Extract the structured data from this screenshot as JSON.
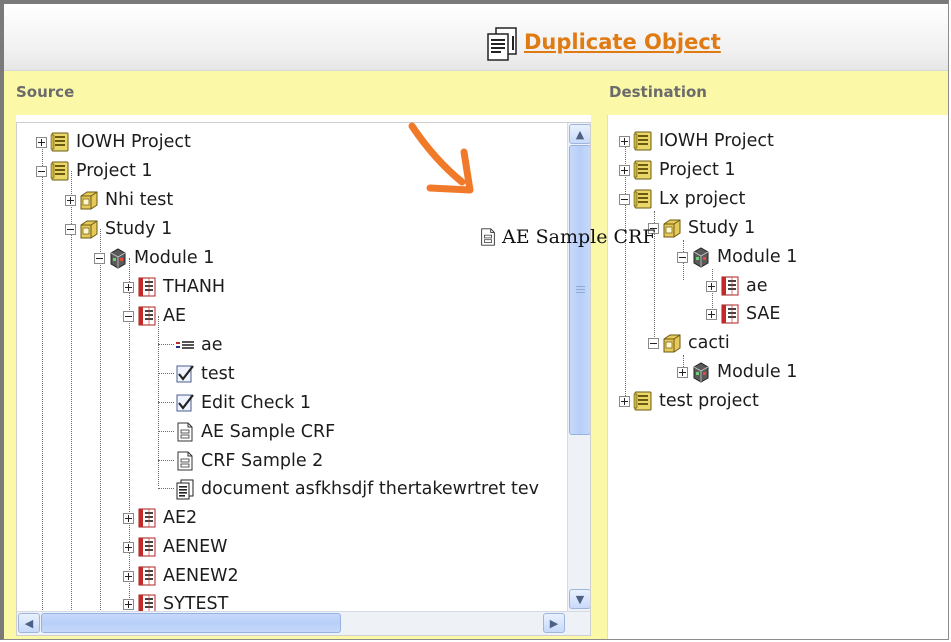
{
  "window": {
    "title": "Duplicate Object",
    "title_icon": "duplicate-document-icon"
  },
  "panes": {
    "source_label": "Source",
    "destination_label": "Destination"
  },
  "drag_ghost": {
    "label": "AE Sample CRF",
    "icon": "crf-form-icon"
  },
  "source_tree": [
    {
      "label": "IOWH Project",
      "icon": "project-icon",
      "state": "collapsed"
    },
    {
      "label": "Project 1",
      "icon": "project-icon",
      "state": "expanded"
    },
    {
      "label": "Nhi test",
      "icon": "study-icon",
      "state": "collapsed"
    },
    {
      "label": "Study 1",
      "icon": "study-icon",
      "state": "expanded"
    },
    {
      "label": "Module 1",
      "icon": "module-icon",
      "state": "expanded"
    },
    {
      "label": "THANH",
      "icon": "form-folder-icon",
      "state": "collapsed"
    },
    {
      "label": "AE",
      "icon": "form-folder-icon",
      "state": "expanded"
    },
    {
      "label": "ae",
      "icon": "list-icon",
      "state": "leaf"
    },
    {
      "label": "test",
      "icon": "edit-check-icon",
      "state": "leaf"
    },
    {
      "label": "Edit Check 1",
      "icon": "edit-check-icon",
      "state": "leaf"
    },
    {
      "label": "AE Sample CRF",
      "icon": "crf-form-icon",
      "state": "leaf"
    },
    {
      "label": "CRF Sample 2",
      "icon": "crf-form-icon",
      "state": "leaf"
    },
    {
      "label": "document asfkhsdjf thertakewrtret tev",
      "icon": "document-icon",
      "state": "leaf"
    },
    {
      "label": "AE2",
      "icon": "form-folder-icon",
      "state": "collapsed"
    },
    {
      "label": "AENEW",
      "icon": "form-folder-icon",
      "state": "collapsed"
    },
    {
      "label": "AENEW2",
      "icon": "form-folder-icon",
      "state": "collapsed"
    },
    {
      "label": "SYTEST",
      "icon": "form-folder-icon",
      "state": "collapsed"
    }
  ],
  "destination_tree": [
    {
      "label": "IOWH Project",
      "icon": "project-icon",
      "state": "collapsed"
    },
    {
      "label": "Project 1",
      "icon": "project-icon",
      "state": "collapsed"
    },
    {
      "label": "Lx project",
      "icon": "project-icon",
      "state": "expanded"
    },
    {
      "label": "Study 1",
      "icon": "study-icon",
      "state": "expanded"
    },
    {
      "label": "Module 1",
      "icon": "module-icon",
      "state": "expanded"
    },
    {
      "label": "ae",
      "icon": "form-folder-icon",
      "state": "collapsed"
    },
    {
      "label": "SAE",
      "icon": "form-folder-icon",
      "state": "collapsed"
    },
    {
      "label": "cacti",
      "icon": "study-icon",
      "state": "expanded"
    },
    {
      "label": "Module 1",
      "icon": "module-icon",
      "state": "collapsed"
    },
    {
      "label": "test project",
      "icon": "project-icon",
      "state": "collapsed"
    }
  ],
  "colors": {
    "title_link": "#e07a12",
    "header_band": "#fbf8a8",
    "scroll_accent": "#b7cff8",
    "annotation_arrow": "#f07a2a"
  }
}
